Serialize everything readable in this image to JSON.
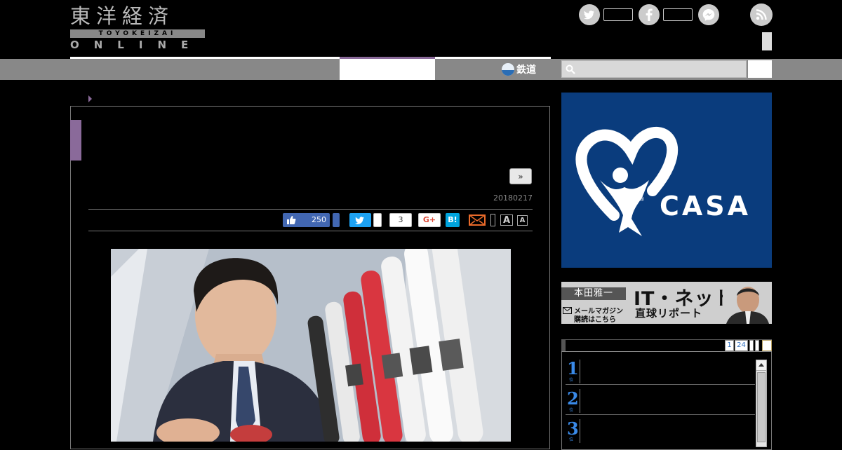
{
  "logo": {
    "kanji": "東洋経済",
    "romaji": "TOYOKEIZAI",
    "online": "ONLINE"
  },
  "nav": {
    "rail_label": "鉄道"
  },
  "search": {
    "placeholder": ""
  },
  "article": {
    "more_label": "»",
    "date": "20180217"
  },
  "share": {
    "fb_count": "250",
    "pocket_count": "3",
    "gplus_label": "G+",
    "hatena_label": "B!",
    "font_large": "A",
    "font_small": "A"
  },
  "ad": {
    "brand": "CASA",
    "reg_mark": "®",
    "brand_color": "#0a3c7d"
  },
  "banner": {
    "author": "本田雅一",
    "title": "IT・ネット",
    "subtitle": "直球リポート",
    "mail_line1": "メールマガジン",
    "mail_line2": "購読はこちら"
  },
  "ranking": {
    "pages": [
      "1",
      "24"
    ],
    "items": [
      {
        "rank": "1",
        "unit": "位"
      },
      {
        "rank": "2",
        "unit": "位"
      },
      {
        "rank": "3",
        "unit": "位"
      }
    ]
  },
  "colors": {
    "accent": "#8a6a9a",
    "navbar": "#888888",
    "rank": "#3a8ae8"
  }
}
